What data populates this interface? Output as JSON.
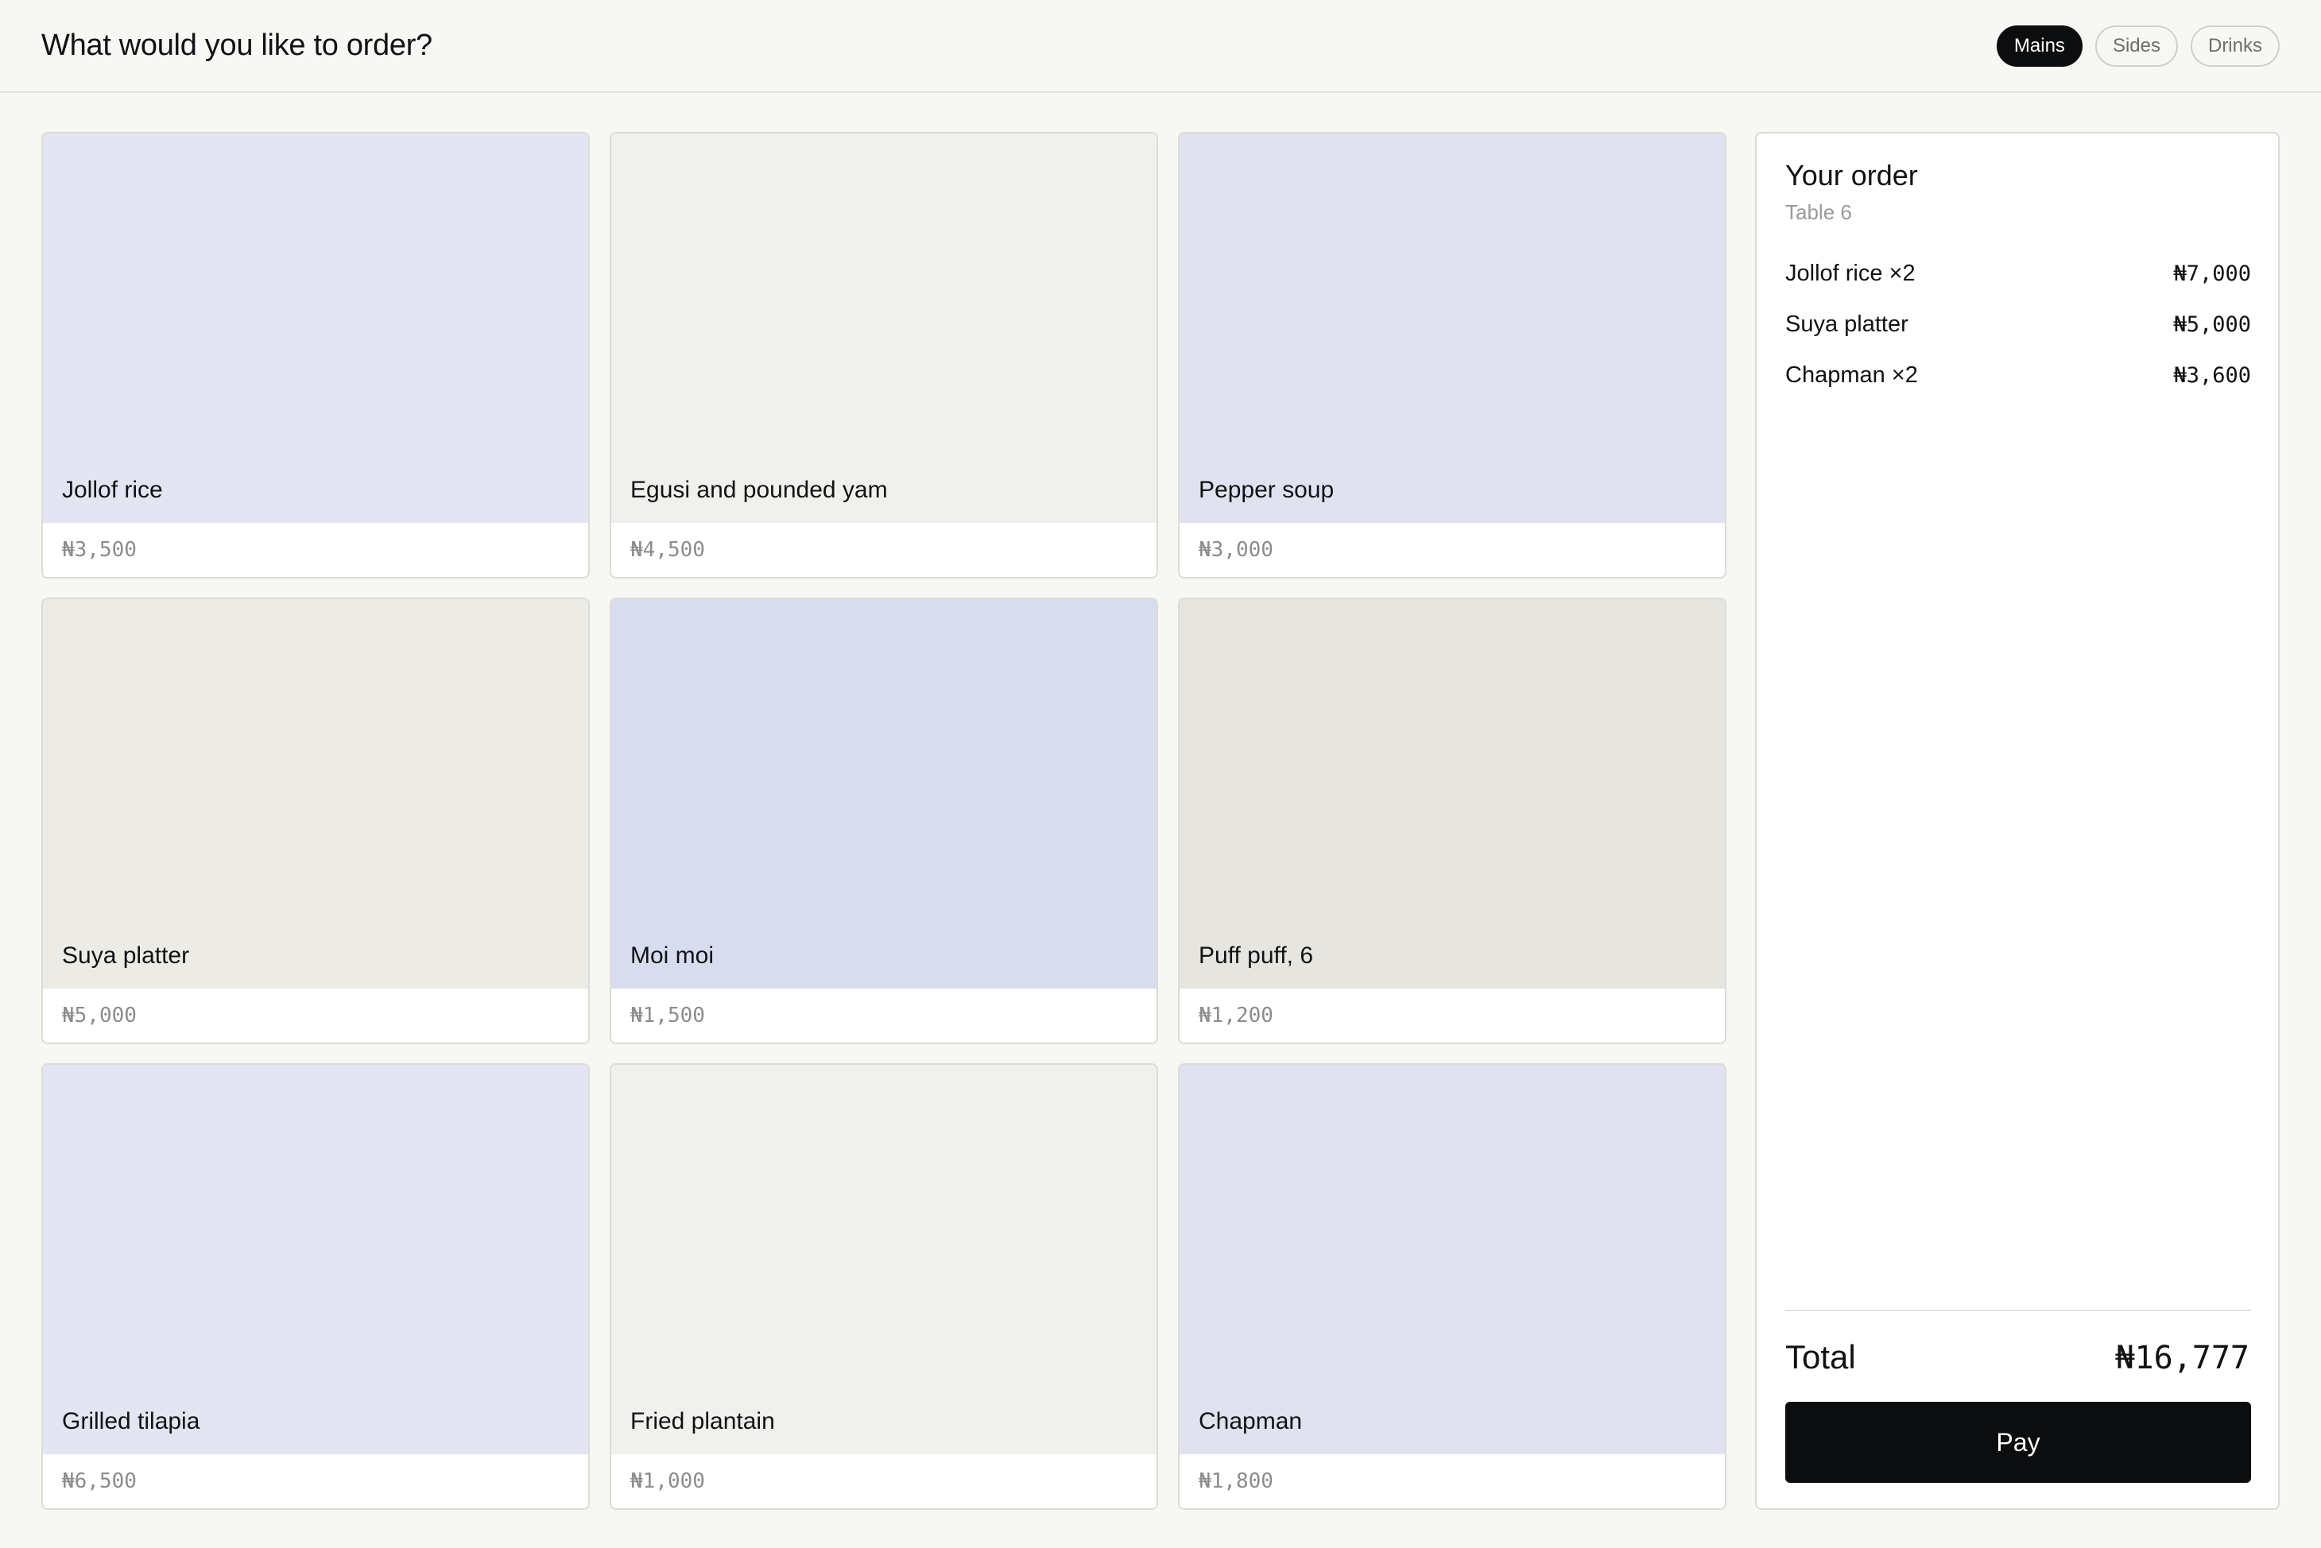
{
  "header": {
    "title": "What would you like to order?",
    "tabs": [
      {
        "label": "Mains",
        "active": true
      },
      {
        "label": "Sides",
        "active": false
      },
      {
        "label": "Drinks",
        "active": false
      }
    ]
  },
  "menu": {
    "items": [
      {
        "name": "Jollof rice",
        "price": "₦3,500",
        "color": "#e3e6f2"
      },
      {
        "name": "Egusi and pounded yam",
        "price": "₦4,500",
        "color": "#f0f0ec"
      },
      {
        "name": "Pepper soup",
        "price": "₦3,000",
        "color": "#e0e2ef"
      },
      {
        "name": "Suya platter",
        "price": "₦5,000",
        "color": "#ecebe6"
      },
      {
        "name": "Moi moi",
        "price": "₦1,500",
        "color": "#d7dcef"
      },
      {
        "name": "Puff puff, 6",
        "price": "₦1,200",
        "color": "#e6e5e0"
      },
      {
        "name": "Grilled tilapia",
        "price": "₦6,500",
        "color": "#e3e6f2"
      },
      {
        "name": "Fried plantain",
        "price": "₦1,000",
        "color": "#f0f0ec"
      },
      {
        "name": "Chapman",
        "price": "₦1,800",
        "color": "#e0e2ef"
      }
    ]
  },
  "order": {
    "title": "Your order",
    "subtitle": "Table 6",
    "lines": [
      {
        "label": "Jollof rice ×2",
        "price": "₦7,000"
      },
      {
        "label": "Suya platter",
        "price": "₦5,000"
      },
      {
        "label": "Chapman ×2",
        "price": "₦3,600"
      }
    ],
    "total_label": "Total",
    "total_value": "₦16,777",
    "pay_label": "Pay"
  },
  "colors": {
    "accent": "#0c0d0f",
    "background": "#f7f7f3"
  }
}
